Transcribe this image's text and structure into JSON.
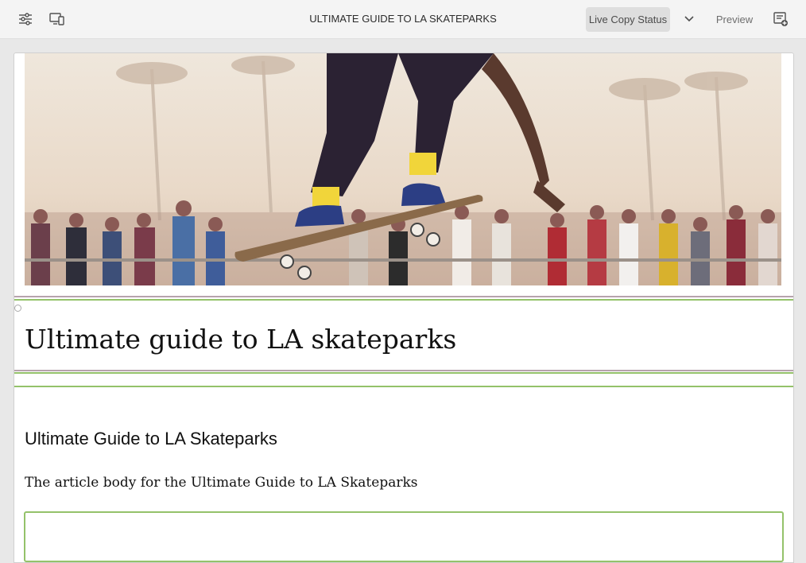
{
  "toolbar": {
    "title": "ULTIMATE GUIDE TO LA SKATEPARKS",
    "live_copy_status": "Live Copy Status",
    "preview": "Preview",
    "icons": [
      "properties-icon",
      "emulator-icon",
      "chevron-down-icon",
      "page-info-icon"
    ]
  },
  "page": {
    "hero_alt": "skateboarder mid-air above a crowd at an LA skatepark",
    "heading": "Ultimate guide to LA skateparks",
    "subheading": "Ultimate Guide to LA Skateparks",
    "body": "The article body for the Ultimate Guide to LA Skateparks"
  },
  "colors": {
    "toolbar_bg": "#f4f4f4",
    "accent_green": "#94c26a",
    "accent_mauve": "#b7a3ad"
  }
}
